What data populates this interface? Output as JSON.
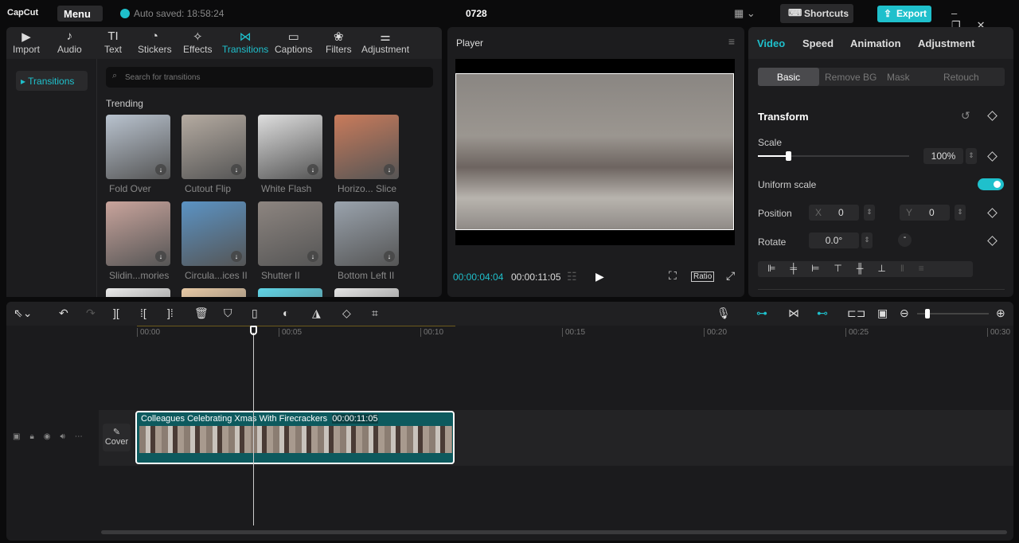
{
  "topbar": {
    "logo": "CapCut",
    "menu": "Menu",
    "autosave": "Auto saved: 18:58:24",
    "project_title": "0728",
    "shortcuts": "Shortcuts",
    "export": "Export"
  },
  "toolbar_tabs": [
    {
      "label": "Import",
      "icon": "▶"
    },
    {
      "label": "Audio",
      "icon": "♪"
    },
    {
      "label": "Text",
      "icon": "TI"
    },
    {
      "label": "Stickers",
      "icon": "◔"
    },
    {
      "label": "Effects",
      "icon": "✧"
    },
    {
      "label": "Transitions",
      "icon": "⋈"
    },
    {
      "label": "Captions",
      "icon": "▭"
    },
    {
      "label": "Filters",
      "icon": "❀"
    },
    {
      "label": "Adjustment",
      "icon": "⚌"
    }
  ],
  "sidebar": {
    "item": "Transitions"
  },
  "search": {
    "placeholder": "Search for transitions"
  },
  "section": "Trending",
  "transitions": [
    {
      "label": "Fold Over",
      "color": "#b9c3cf"
    },
    {
      "label": "Cutout Flip",
      "color": "#b5aba1"
    },
    {
      "label": "White Flash",
      "color": "#dedede"
    },
    {
      "label": "Horizo... Slice",
      "color": "#c97b5b"
    },
    {
      "label": "Slidin...mories",
      "color": "#c9a49c"
    },
    {
      "label": "Circula...ices II",
      "color": "#5b93c4"
    },
    {
      "label": "Shutter II",
      "color": "#8d8580"
    },
    {
      "label": "Bottom Left II",
      "color": "#9aa3ad"
    },
    {
      "label": "",
      "color": "#e9e9e9"
    },
    {
      "label": "",
      "color": "#e7c9a5"
    },
    {
      "label": "",
      "color": "#5fd4e6"
    },
    {
      "label": "",
      "color": "#e3e3e3"
    }
  ],
  "player": {
    "title": "Player",
    "current_time": "00:00:04:04",
    "duration": "00:00:11:05",
    "ratio": "Ratio"
  },
  "inspector": {
    "tabs": [
      "Video",
      "Speed",
      "Animation",
      "Adjustment"
    ],
    "subtabs": [
      "Basic",
      "Remove BG",
      "Mask",
      "Retouch"
    ],
    "section": "Transform",
    "scale_label": "Scale",
    "scale_value": "100%",
    "scale_fraction": 0.2,
    "uniform_label": "Uniform scale",
    "uniform_on": true,
    "position_label": "Position",
    "x_label": "X",
    "x": "0",
    "y_label": "Y",
    "y": "0",
    "rotate_label": "Rotate",
    "rotate": "0.0°"
  },
  "timeline": {
    "ticks": [
      "00:00",
      "00:05",
      "00:10",
      "00:15",
      "00:20",
      "00:25",
      "00:30"
    ],
    "cover": "Cover",
    "clip_title": "Colleagues Celebrating Xmas With Firecrackers",
    "clip_duration": "00:00:11:05"
  },
  "colors": {
    "accent": "#1fc0cc"
  }
}
